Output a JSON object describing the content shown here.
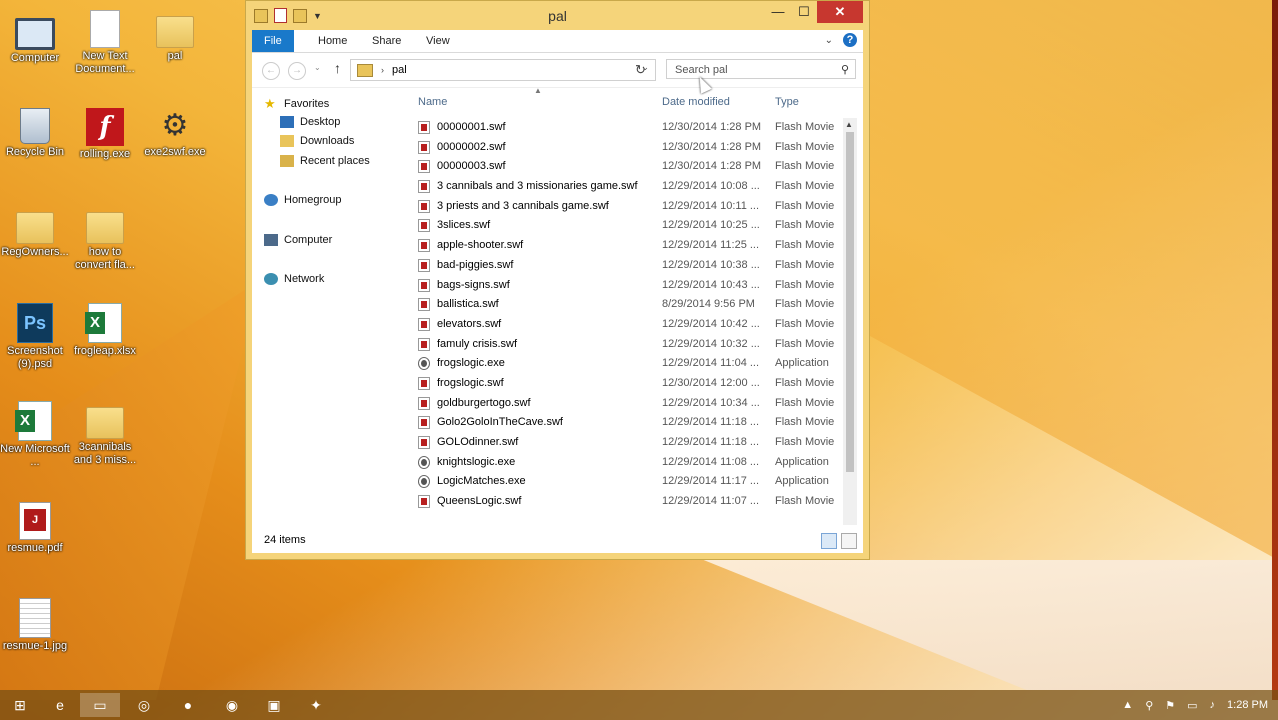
{
  "desktop": {
    "icons": [
      {
        "label": "Computer"
      },
      {
        "label": "New Text Document..."
      },
      {
        "label": "pal"
      },
      {
        "label": "Recycle Bin"
      },
      {
        "label": "rolling.exe"
      },
      {
        "label": "exe2swf.exe"
      },
      {
        "label": "RegOwners..."
      },
      {
        "label": "how to convert fla..."
      },
      {
        "label": "Screenshot (9).psd"
      },
      {
        "label": "frogleap.xlsx"
      },
      {
        "label": "New Microsoft ..."
      },
      {
        "label": "3cannibals and 3 miss..."
      },
      {
        "label": "resmue.pdf"
      },
      {
        "label": "resmue-1.jpg"
      }
    ]
  },
  "window": {
    "title": "pal",
    "ribbon_tabs": [
      "File",
      "Home",
      "Share",
      "View"
    ],
    "address_path": "pal",
    "search_placeholder": "Search pal",
    "columns": {
      "name": "Name",
      "date": "Date modified",
      "type": "Type"
    },
    "nav": {
      "favorites": "Favorites",
      "desktop": "Desktop",
      "downloads": "Downloads",
      "recent": "Recent places",
      "homegroup": "Homegroup",
      "computer": "Computer",
      "network": "Network"
    },
    "files": [
      {
        "name": "00000001.swf",
        "date": "12/30/2014 1:28 PM",
        "type": "Flash Movie",
        "kind": "swf"
      },
      {
        "name": "00000002.swf",
        "date": "12/30/2014 1:28 PM",
        "type": "Flash Movie",
        "kind": "swf"
      },
      {
        "name": "00000003.swf",
        "date": "12/30/2014 1:28 PM",
        "type": "Flash Movie",
        "kind": "swf"
      },
      {
        "name": "3 cannibals and 3 missionaries game.swf",
        "date": "12/29/2014 10:08 ...",
        "type": "Flash Movie",
        "kind": "swf"
      },
      {
        "name": "3 priests and 3 cannibals game.swf",
        "date": "12/29/2014 10:11 ...",
        "type": "Flash Movie",
        "kind": "swf"
      },
      {
        "name": "3slices.swf",
        "date": "12/29/2014 10:25 ...",
        "type": "Flash Movie",
        "kind": "swf"
      },
      {
        "name": "apple-shooter.swf",
        "date": "12/29/2014 11:25 ...",
        "type": "Flash Movie",
        "kind": "swf"
      },
      {
        "name": "bad-piggies.swf",
        "date": "12/29/2014 10:38 ...",
        "type": "Flash Movie",
        "kind": "swf"
      },
      {
        "name": "bags-signs.swf",
        "date": "12/29/2014 10:43 ...",
        "type": "Flash Movie",
        "kind": "swf"
      },
      {
        "name": "ballistica.swf",
        "date": "8/29/2014 9:56 PM",
        "type": "Flash Movie",
        "kind": "swf"
      },
      {
        "name": "elevators.swf",
        "date": "12/29/2014 10:42 ...",
        "type": "Flash Movie",
        "kind": "swf"
      },
      {
        "name": "famuly crisis.swf",
        "date": "12/29/2014 10:32 ...",
        "type": "Flash Movie",
        "kind": "swf"
      },
      {
        "name": "frogslogic.exe",
        "date": "12/29/2014 11:04 ...",
        "type": "Application",
        "kind": "exe"
      },
      {
        "name": "frogslogic.swf",
        "date": "12/30/2014 12:00 ...",
        "type": "Flash Movie",
        "kind": "swf"
      },
      {
        "name": "goldburgertogo.swf",
        "date": "12/29/2014 10:34 ...",
        "type": "Flash Movie",
        "kind": "swf"
      },
      {
        "name": "Golo2GoloInTheCave.swf",
        "date": "12/29/2014 11:18 ...",
        "type": "Flash Movie",
        "kind": "swf"
      },
      {
        "name": "GOLOdinner.swf",
        "date": "12/29/2014 11:18 ...",
        "type": "Flash Movie",
        "kind": "swf"
      },
      {
        "name": "knightslogic.exe",
        "date": "12/29/2014 11:08 ...",
        "type": "Application",
        "kind": "exe"
      },
      {
        "name": "LogicMatches.exe",
        "date": "12/29/2014 11:17 ...",
        "type": "Application",
        "kind": "exe"
      },
      {
        "name": "QueensLogic.swf",
        "date": "12/29/2014 11:07 ...",
        "type": "Flash Movie",
        "kind": "swf"
      }
    ],
    "status_count": "24 items"
  },
  "taskbar": {
    "clock": "1:28 PM"
  }
}
